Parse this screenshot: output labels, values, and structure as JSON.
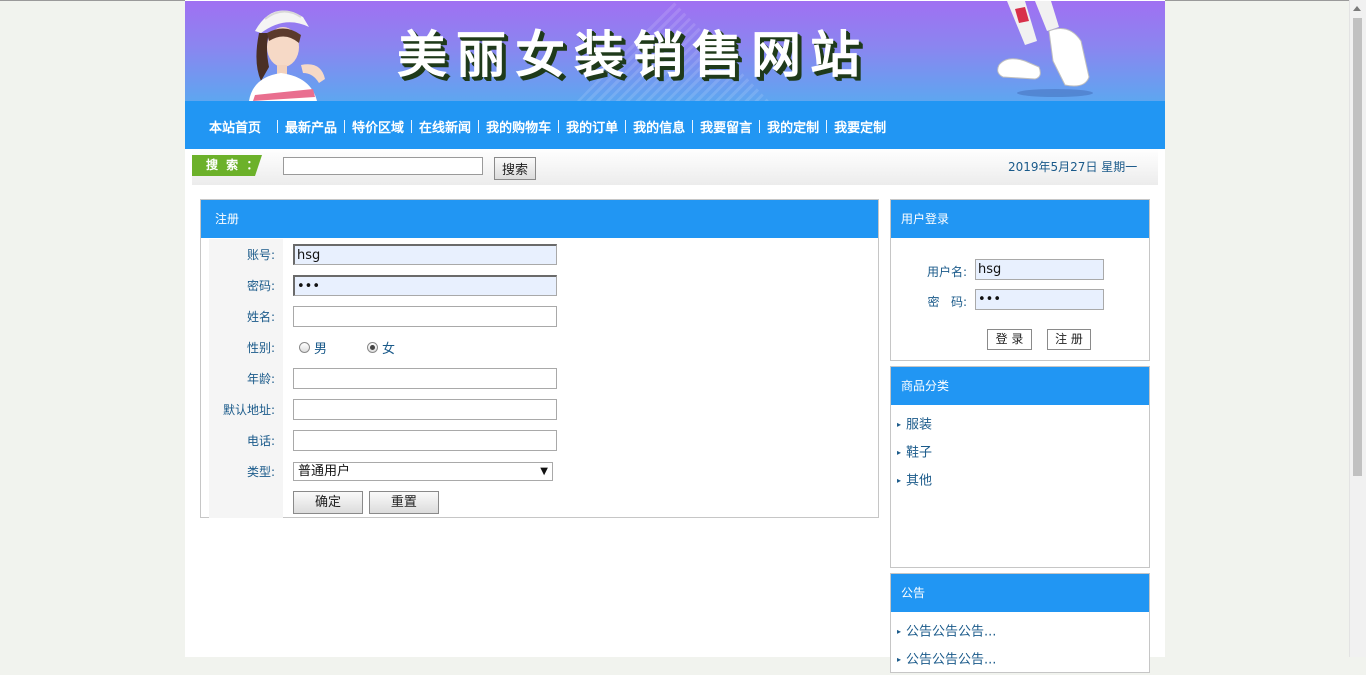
{
  "banner": {
    "title": "美丽女装销售网站"
  },
  "nav": {
    "items": [
      "本站首页",
      "最新产品",
      "特价区域",
      "在线新闻",
      "我的购物车",
      "我的订单",
      "我的信息",
      "我要留言",
      "我的定制",
      "我要定制"
    ]
  },
  "search": {
    "tag": "搜 索 ：",
    "value": "",
    "button": "搜索",
    "date": "2019年5月27日 星期一"
  },
  "register": {
    "title": "注册",
    "account_label": "账号:",
    "account_value": "hsg",
    "password_label": "密码:",
    "password_value": "•••",
    "name_label": "姓名:",
    "name_value": "",
    "gender_label": "性别:",
    "gender_male": "男",
    "gender_female": "女",
    "gender_selected": "女",
    "age_label": "年龄:",
    "age_value": "",
    "address_label": "默认地址:",
    "address_value": "",
    "phone_label": "电话:",
    "phone_value": "",
    "type_label": "类型:",
    "type_selected": "普通用户",
    "confirm_button": "确定",
    "reset_button": "重置"
  },
  "login": {
    "title": "用户登录",
    "username_label": "用户名:",
    "username_value": "hsg",
    "password_label": "密   码:",
    "password_value": "•••",
    "login_button": "登 录",
    "register_button": "注 册"
  },
  "categories": {
    "title": "商品分类",
    "items": [
      "服装",
      "鞋子",
      "其他"
    ]
  },
  "notice": {
    "title": "公告",
    "items": [
      "公告公告公告...",
      "公告公告公告..."
    ]
  },
  "colors": {
    "nav_blue": "#2196f3",
    "banner_top": "#a070f2",
    "banner_bottom": "#5ea6f0",
    "search_tag_green": "#6cb12a",
    "link_text": "#1a5a8a"
  }
}
